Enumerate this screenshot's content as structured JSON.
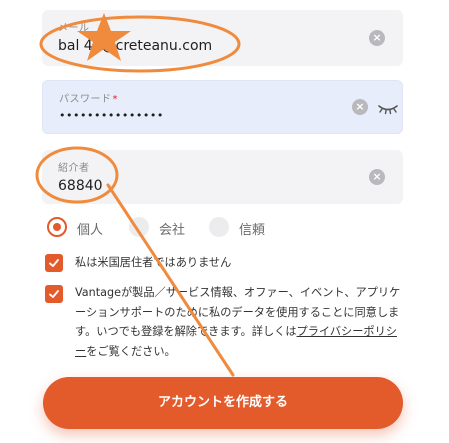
{
  "form": {
    "email": {
      "label": "メール",
      "value": "bal 45@creteanu.com"
    },
    "password": {
      "label": "パスワード",
      "required_mark": "*",
      "value": "•••••••••••••••"
    },
    "referral": {
      "label": "紹介者",
      "value": "68840"
    },
    "clear_symbol": "×",
    "account_type": {
      "options": [
        {
          "label": "個人",
          "selected": true
        },
        {
          "label": "会社",
          "selected": false
        },
        {
          "label": "信頼",
          "selected": false
        }
      ]
    },
    "checkboxes": {
      "not_us": "私は米国居住者ではありません",
      "consent_before": "Vantageが製品／サービス情報、オファー、イベント、アプリケーションサポートのために私のデータを使用することに同意します。いつでも登録を解除できます。詳しくは",
      "consent_link": "プライバシーポリシー",
      "consent_after": "をご覧ください。"
    },
    "submit_label": "アカウントを作成する"
  },
  "colors": {
    "accent": "#e35a2b",
    "annotation": "#f08a3c"
  }
}
